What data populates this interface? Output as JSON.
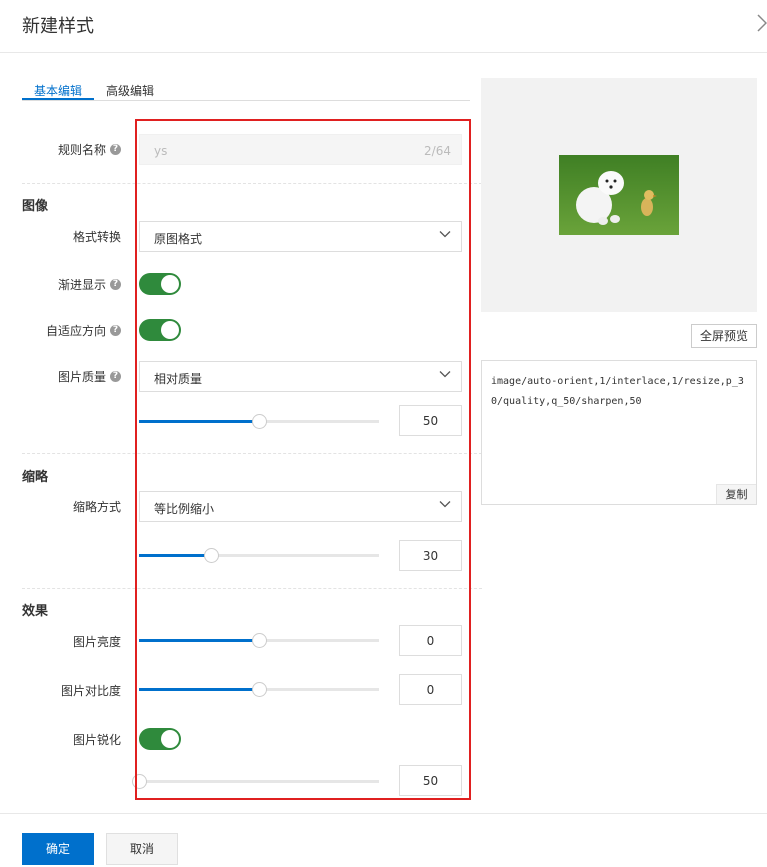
{
  "header": {
    "title": "新建样式"
  },
  "tabs": [
    {
      "label": "基本编辑",
      "active": true
    },
    {
      "label": "高级编辑",
      "active": false
    }
  ],
  "rule_name": {
    "label": "规则名称",
    "value": "ys",
    "count": "2/64"
  },
  "sections": {
    "image": "图像",
    "thumbnail": "缩略",
    "effects": "效果"
  },
  "format": {
    "label": "格式转换",
    "selected": "原图格式"
  },
  "progressive": {
    "label": "渐进显示",
    "on": true
  },
  "auto_orient": {
    "label": "自适应方向",
    "on": true
  },
  "quality": {
    "label": "图片质量",
    "selected": "相对质量",
    "value": "50",
    "fraction": 0.5
  },
  "resize": {
    "label": "缩略方式",
    "selected": "等比例缩小",
    "value": "30",
    "fraction": 0.3
  },
  "brightness": {
    "label": "图片亮度",
    "value": "0",
    "fraction": 0.5
  },
  "contrast": {
    "label": "图片对比度",
    "value": "0",
    "fraction": 0.5
  },
  "sharpen": {
    "label": "图片锐化",
    "on": true,
    "value": "50",
    "fraction": 0.0
  },
  "preview": {
    "fullscreen_label": "全屏预览"
  },
  "code": {
    "text": "image/auto-orient,1/interlace,1/resize,p_30/quality,q_50/sharpen,50",
    "copy_label": "复制"
  },
  "footer": {
    "confirm_label": "确定",
    "cancel_label": "取消"
  },
  "colors": {
    "primary": "#0070cc",
    "toggle_on": "#2f8a3c",
    "highlight": "#e02020"
  }
}
